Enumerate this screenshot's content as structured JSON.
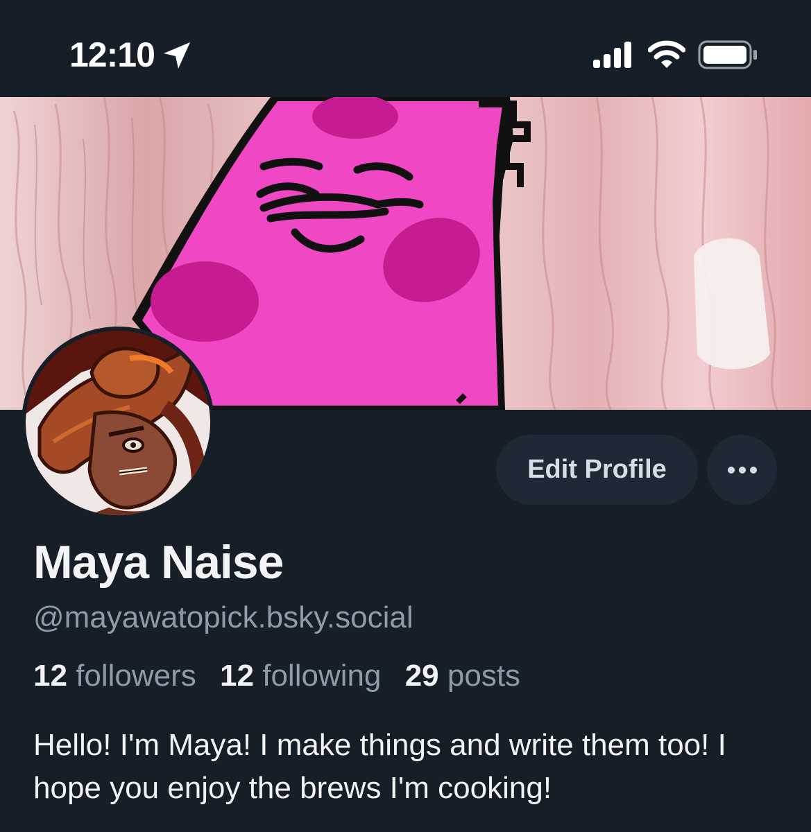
{
  "status_bar": {
    "time": "12:10"
  },
  "profile": {
    "display_name": "Maya Naise",
    "handle": "@mayawatopick.bsky.social",
    "stats": {
      "followers_count": "12",
      "followers_label": "followers",
      "following_count": "12",
      "following_label": "following",
      "posts_count": "29",
      "posts_label": "posts"
    },
    "bio": "Hello! I'm Maya! I make things and write them too! I hope you enjoy the brews I'm cooking!"
  },
  "actions": {
    "edit_label": "Edit Profile"
  },
  "colors": {
    "background": "#161e27",
    "button_bg": "#1e2935",
    "muted_text": "#8e9bab",
    "banner_pink": "#f03cbf"
  },
  "icons": [
    "location-arrow-icon",
    "signal-icon",
    "wifi-icon",
    "battery-icon",
    "more-dots-icon"
  ]
}
